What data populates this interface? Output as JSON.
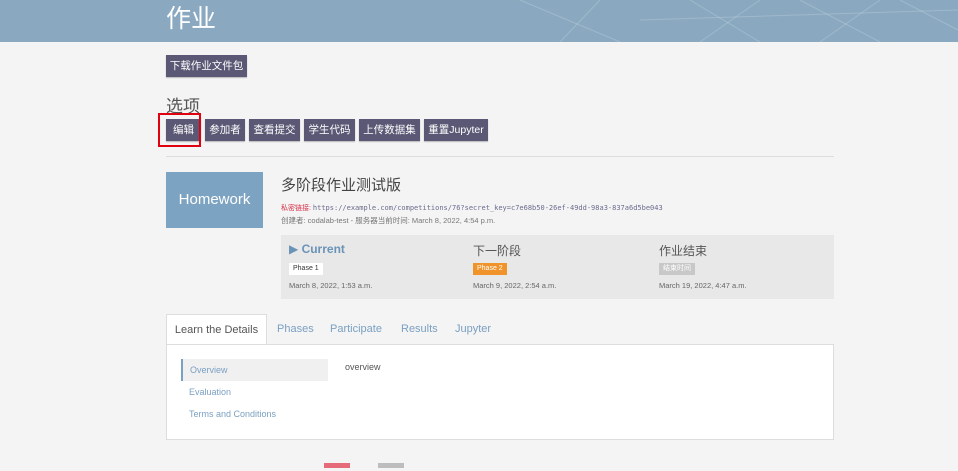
{
  "header": {
    "title": "作业"
  },
  "download_button": "下载作业文件包",
  "options_title": "选项",
  "option_buttons": [
    "编辑",
    "参加者",
    "查看提交",
    "学生代码",
    "上传数据集",
    "重置Jupyter"
  ],
  "competition": {
    "logo_text": "Homework",
    "title": "多阶段作业测试版",
    "secret_label": "私密链接:",
    "secret_url": "https://example.com/competitions/76?secret_key=c7e68b50-26ef-49dd-98a3-837a6d5be043",
    "creator_line": "创建者:  codalab-test - 服务器当前时间: March 8, 2022, 4:54 p.m."
  },
  "phases": [
    {
      "heading": "▶ Current",
      "badge": "Phase 1",
      "date": "March 8, 2022, 1:53 a.m."
    },
    {
      "heading": "下一阶段",
      "badge": "Phase 2",
      "date": "March 9, 2022, 2:54 a.m."
    },
    {
      "heading": "作业结束",
      "badge": "结束时间",
      "date": "March 19, 2022, 4:47 a.m."
    }
  ],
  "tabs": [
    "Learn the Details",
    "Phases",
    "Participate",
    "Results",
    "Jupyter"
  ],
  "sidebar": [
    "Overview",
    "Evaluation",
    "Terms and Conditions"
  ],
  "content": "overview",
  "colors": {
    "header": "#8aa9c0",
    "button": "#5a5874",
    "accent": "#7aa0c2",
    "phase2": "#f0932b",
    "highlight": "#e0000f"
  }
}
